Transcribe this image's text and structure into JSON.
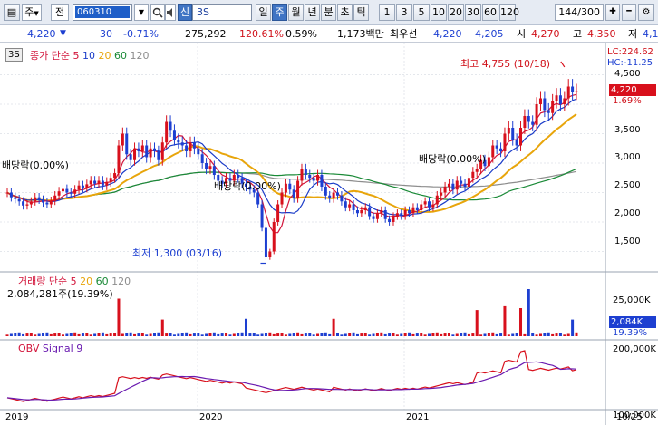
{
  "toolbar": {
    "menu_glyph": "▤",
    "combo_label": "주",
    "pair_label": "전",
    "code": "060310",
    "badge": "신",
    "name": "3S",
    "periods": [
      "일",
      "주",
      "월",
      "년",
      "분",
      "초",
      "틱"
    ],
    "active_period": "주",
    "intervals": [
      "1",
      "3",
      "5",
      "10",
      "20",
      "30",
      "60",
      "120"
    ],
    "counter": "144/300"
  },
  "quote": {
    "price": "4,220",
    "change_arrow": "▼",
    "change": "30",
    "change_pct": "-0.71%",
    "volume": "275,292",
    "vol_ratio": "120.61%",
    "turnover_pct": "0.59%",
    "amount": "1,173백만",
    "pref_label": "최우선",
    "ask": "4,220",
    "bid": "4,205",
    "open_label": "시",
    "open": "4,270",
    "high_label": "고",
    "high": "4,350",
    "low_label": "저",
    "low": "4,1"
  },
  "price_panel": {
    "tag": "3S",
    "title": "종가 단순",
    "ma": [
      "5",
      "10",
      "20",
      "60",
      "120"
    ],
    "ma_colors": [
      "#d2143a",
      "#1b3cc8",
      "#e8a50b",
      "#1a8a37",
      "#8d8d8d"
    ],
    "lc_label": "LC:224.62",
    "hc_label": "HC:-11.25",
    "yticks": [
      "4,500",
      "3,500",
      "3,000",
      "2,500",
      "2,000",
      "1,500"
    ],
    "current_price": "4,220",
    "current_pct": "1.69%",
    "annotations": {
      "high": "최고 4,755 (10/18)",
      "low": "최저 1,300 (03/16)",
      "div1": "배당락(0.00%)",
      "div2": "배당락(0.00%)",
      "div3": "배당락(0.00%)"
    }
  },
  "volume_panel": {
    "title": "거래량",
    "ma_label": "단순",
    "ma": [
      "5",
      "20",
      "60",
      "120"
    ],
    "value": "2,084,281주(19.39%)",
    "ytick": "25,000K",
    "current": "2,084K",
    "current_pct": "19.39%"
  },
  "obv_panel": {
    "title": "OBV",
    "signal": "Signal 9",
    "yticks": [
      "200,000K",
      "100,000K"
    ]
  },
  "xaxis": [
    "2019",
    "2020",
    "2021",
    "10/25"
  ],
  "chart_data": {
    "type": "candlestick",
    "ylim": [
      1200,
      4800
    ],
    "closes": [
      2500,
      2420,
      2390,
      2350,
      2280,
      2300,
      2350,
      2420,
      2380,
      2330,
      2300,
      2360,
      2450,
      2520,
      2560,
      2500,
      2480,
      2550,
      2620,
      2580,
      2640,
      2700,
      2650,
      2700,
      2620,
      2680,
      2750,
      2830,
      3300,
      3500,
      3150,
      3050,
      3250,
      3200,
      3300,
      3100,
      3250,
      3200,
      3050,
      3350,
      3700,
      3550,
      3400,
      3350,
      3300,
      3200,
      3350,
      3250,
      3150,
      3000,
      2900,
      2950,
      2800,
      2700,
      2650,
      2750,
      2700,
      2800,
      2750,
      2650,
      2600,
      2550,
      2500,
      2300,
      1900,
      1400,
      1500,
      2000,
      2300,
      2500,
      2650,
      2550,
      2400,
      2700,
      2900,
      2800,
      2750,
      2700,
      2800,
      2600,
      2450,
      2400,
      2500,
      2450,
      2350,
      2250,
      2300,
      2200,
      2150,
      2200,
      2250,
      2100,
      2050,
      2150,
      2200,
      2050,
      2000,
      2100,
      2150,
      2100,
      2200,
      2150,
      2250,
      2200,
      2300,
      2350,
      2250,
      2300,
      2450,
      2500,
      2600,
      2650,
      2550,
      2700,
      2650,
      2600,
      2750,
      2850,
      2900,
      3050,
      2950,
      3100,
      3300,
      3250,
      3200,
      3500,
      3600,
      3400,
      3300,
      3600,
      3800,
      3700,
      3650,
      4000,
      4100,
      3900,
      3850,
      4050,
      4150,
      4000,
      4100,
      4300,
      4200,
      4220
    ],
    "volume_spikes": {
      "28": 7.5,
      "39": 2.0,
      "60": 2.2,
      "82": 2.2,
      "118": 4.5,
      "125": 5.5,
      "129": 5.0,
      "131": 10.0,
      "142": 2.0
    },
    "annotations": [
      {
        "label": "최고",
        "value": 4755,
        "date": "10/18"
      },
      {
        "label": "최저",
        "value": 1300,
        "date": "03/16"
      }
    ]
  }
}
